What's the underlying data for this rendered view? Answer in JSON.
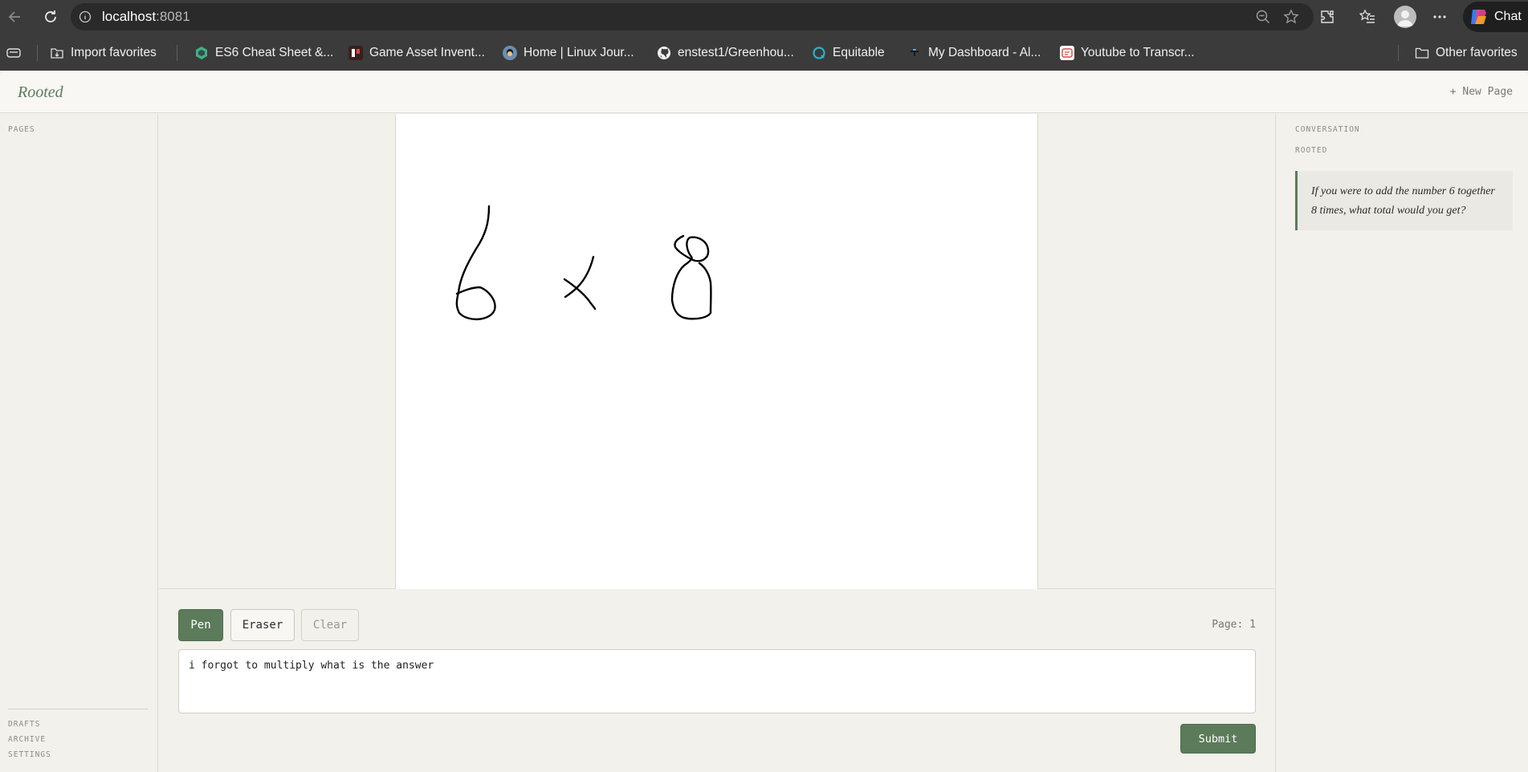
{
  "browser": {
    "url_host": "localhost",
    "url_port": ":8081",
    "chat_label": "Chat",
    "bookmarks": [
      {
        "label": "Import favorites",
        "icon": "import-icon"
      },
      {
        "label": "ES6 Cheat Sheet &...",
        "icon": "es6-favicon"
      },
      {
        "label": "Game Asset Invent...",
        "icon": "game-asset-favicon"
      },
      {
        "label": "Home | Linux Jour...",
        "icon": "linux-journal-favicon"
      },
      {
        "label": "enstest1/Greenhou...",
        "icon": "github-icon"
      },
      {
        "label": "Equitable",
        "icon": "equitable-favicon"
      },
      {
        "label": "My Dashboard - Al...",
        "icon": "dashboard-favicon"
      },
      {
        "label": "Youtube to Transcr...",
        "icon": "youtube-transcript-favicon"
      }
    ],
    "other_favorites": "Other favorites"
  },
  "app": {
    "brand": "Rooted",
    "new_page": "+ New Page"
  },
  "sidebar": {
    "pages_label": "PAGES",
    "drafts": "DRAFTS",
    "archive": "ARCHIVE",
    "settings": "SETTINGS"
  },
  "toolbar": {
    "pen": "Pen",
    "eraser": "Eraser",
    "clear": "Clear",
    "active_tool": "Pen",
    "page_indicator": "Page: 1"
  },
  "prompt": {
    "value": "i forgot to multiply what is the answer"
  },
  "submit_label": "Submit",
  "conversation": {
    "label": "CONVERSATION",
    "speaker": "ROOTED",
    "message": "If you were to add the number 6 together 8 times, what total would you get?"
  },
  "colors": {
    "accent": "#5b7b5a",
    "chrome": "#3b3b3b",
    "app_bg": "#f2f1ec"
  }
}
